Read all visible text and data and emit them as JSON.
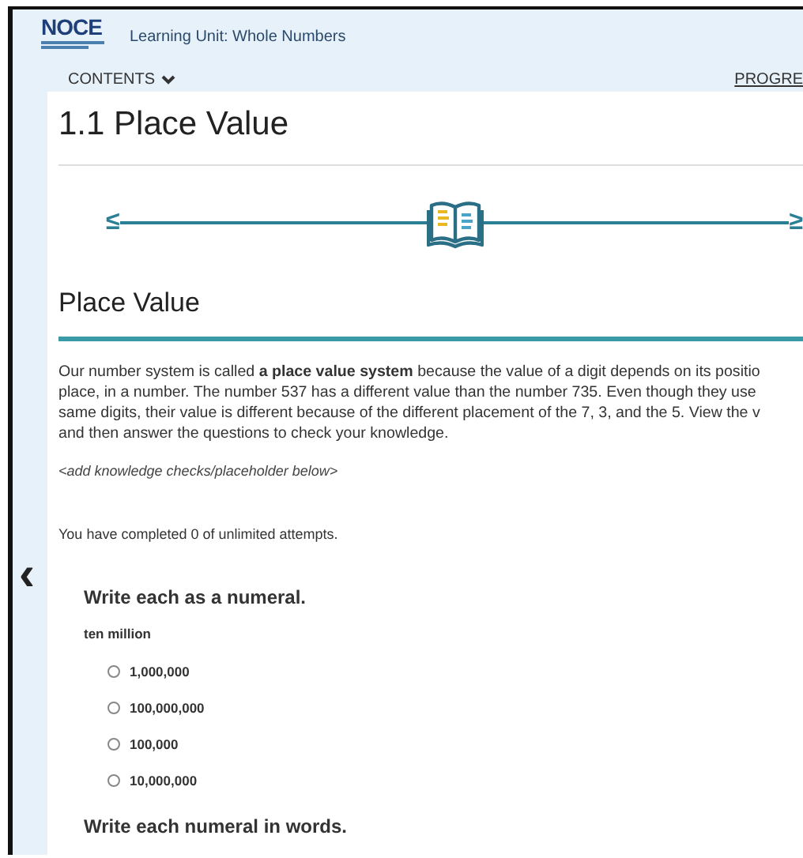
{
  "header": {
    "logo": "NOCE",
    "unit_title": "Learning Unit: Whole Numbers"
  },
  "nav": {
    "contents": "CONTENTS",
    "progress": "PROGRE"
  },
  "page_title": "1.1 Place Value",
  "pager": {
    "prev": "≤",
    "next": "≥"
  },
  "section_title": "Place Value",
  "intro": "Our number system is called **a place value system** because the value of a digit depends on its positio\nplace, in a number. The number 537 has a different value than the number 735. Even though they use\nsame digits, their value is different because of the different placement of the 7, 3, and the 5. View the v\nand then answer the questions to check your knowledge.",
  "placeholder_note": "<add knowledge checks/placeholder below>",
  "attempts": "You have completed 0 of unlimited attempts.",
  "side_nav": {
    "prev": "‹"
  },
  "questions": [
    {
      "title": "Write each as a numeral.",
      "prompt": "ten million",
      "options": [
        {
          "label": "1,000,000",
          "selected": false
        },
        {
          "label": "100,000,000",
          "selected": false
        },
        {
          "label": "100,000",
          "selected": false
        },
        {
          "label": "10,000,000",
          "selected": false
        }
      ]
    },
    {
      "title": "Write each numeral in words."
    }
  ]
}
